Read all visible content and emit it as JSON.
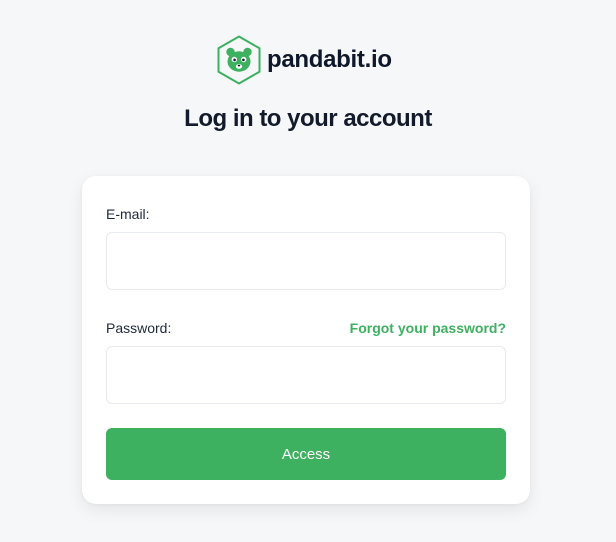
{
  "brand": {
    "name": "pandabit.io",
    "logo_icon": "panda-hexagon-icon",
    "accent_color": "#3db160"
  },
  "page": {
    "title": "Log in to your account"
  },
  "form": {
    "email_label": "E-mail:",
    "email_value": "",
    "password_label": "Password:",
    "password_value": "",
    "forgot_password_label": "Forgot your password?",
    "submit_label": "Access"
  }
}
